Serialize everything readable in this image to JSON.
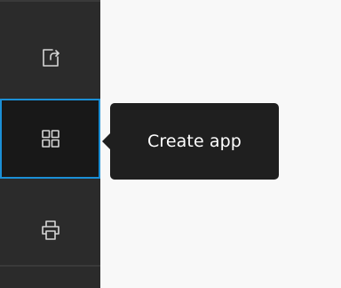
{
  "sidebar": {
    "items": [
      {
        "icon": "share-icon",
        "active": false
      },
      {
        "icon": "grid-apps-icon",
        "active": true
      },
      {
        "icon": "printer-icon",
        "active": false
      }
    ]
  },
  "tooltip": {
    "label": "Create app"
  },
  "colors": {
    "sidebar_bg": "#2b2b2b",
    "active_bg": "#181818",
    "active_border": "#1b8fd6",
    "icon": "#d6d6d6",
    "tooltip_bg": "#1f1f1f",
    "canvas_bg": "#f8f8f8"
  }
}
